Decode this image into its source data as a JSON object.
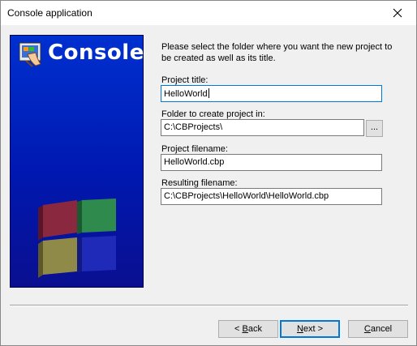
{
  "window": {
    "title": "Console application"
  },
  "banner": {
    "title": "Console"
  },
  "intro": "Please select the folder where you want the new project to be created as well as its title.",
  "fields": {
    "project_title": {
      "label": "Project title:",
      "value": "HelloWorld"
    },
    "folder": {
      "label": "Folder to create project in:",
      "value": "C:\\CBProjects\\",
      "browse_label": "..."
    },
    "project_filename": {
      "label": "Project filename:",
      "value": "HelloWorld.cbp"
    },
    "resulting_filename": {
      "label": "Resulting filename:",
      "value": "C:\\CBProjects\\HelloWorld\\HelloWorld.cbp"
    }
  },
  "buttons": {
    "back": {
      "mnemonic": "B",
      "rest": "ack",
      "prefix": "< "
    },
    "next": {
      "mnemonic": "N",
      "rest": "ext",
      "suffix": " >"
    },
    "cancel": {
      "mnemonic": "C",
      "rest": "ancel"
    }
  },
  "icons": {
    "close": "close-icon",
    "app": "console-app-icon",
    "cubes": "cubes-logo-icon"
  }
}
